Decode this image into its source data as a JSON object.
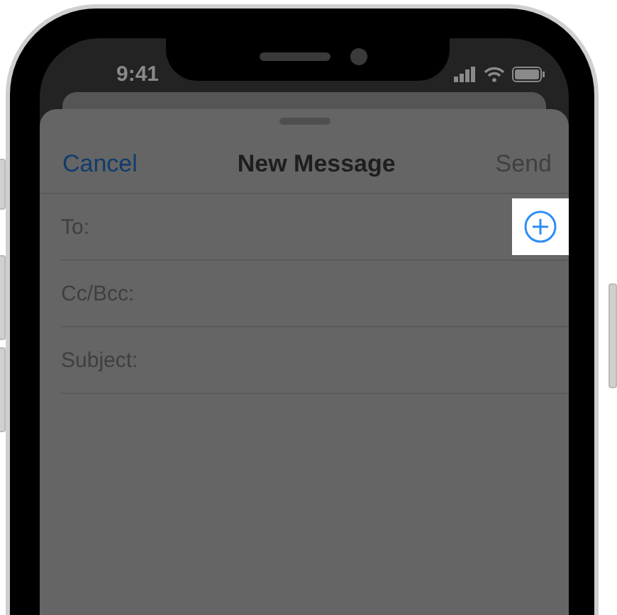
{
  "status_bar": {
    "time": "9:41"
  },
  "nav": {
    "cancel": "Cancel",
    "title": "New Message",
    "send": {
      "label": "Send",
      "disabled": true
    }
  },
  "fields": [
    {
      "label": "To:",
      "kind": "recipient"
    },
    {
      "label": "Cc/Bcc:",
      "kind": "plain"
    },
    {
      "label": "Subject:",
      "kind": "plain"
    }
  ]
}
